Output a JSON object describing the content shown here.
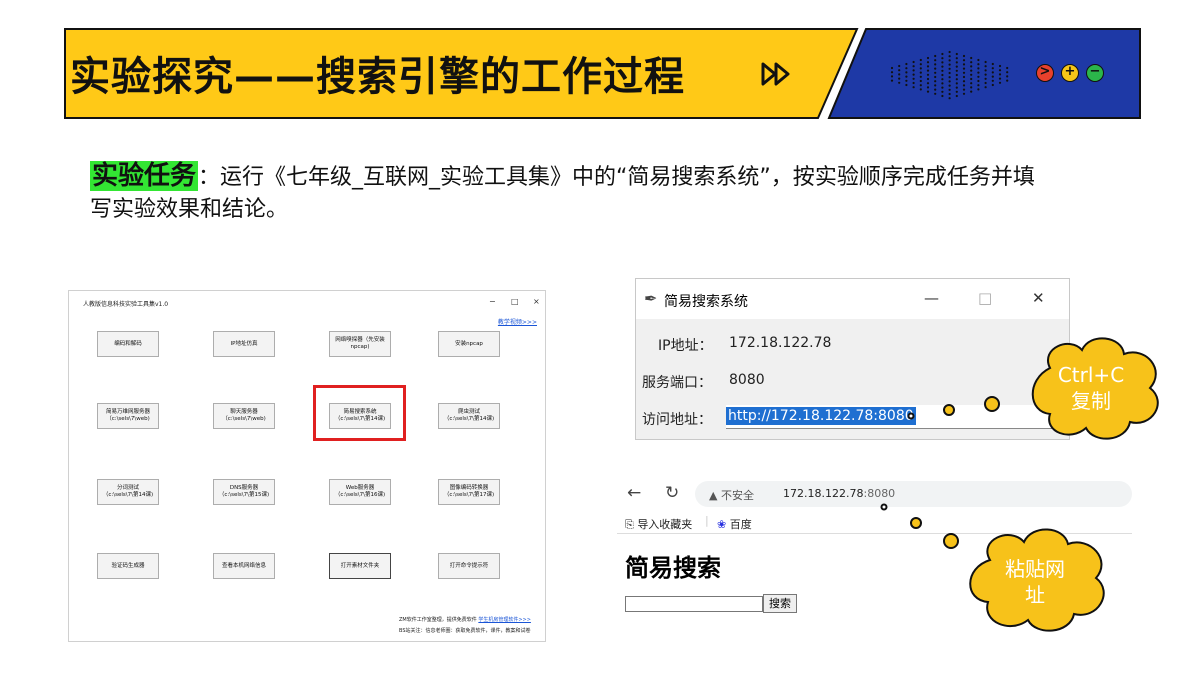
{
  "header": {
    "title": "实验探究——搜索引擎的工作过程",
    "forward_icon": "fast-forward-icon",
    "window_dots": [
      {
        "symbol": ">",
        "color": "#e8412c"
      },
      {
        "symbol": "+",
        "color": "#f5c518"
      },
      {
        "symbol": "−",
        "color": "#2bb64a"
      }
    ]
  },
  "colors": {
    "banner_yellow": "#ffc917",
    "banner_blue": "#1e39a6",
    "task_highlight": "#33e633",
    "red_box": "#e02020",
    "cloud": "#f7c21a"
  },
  "task": {
    "label": "实验任务",
    "text": "：运行《七年级_互联网_实验工具集》中的“简易搜索系统”，按实验顺序完成任务并填写实验效果和结论。"
  },
  "tool_window": {
    "title": "人教版信息科技实验工具集v1.0",
    "controls": [
      "−",
      "□",
      "×"
    ],
    "help_link": "教学视频>>>",
    "buttons": [
      "编码和解码",
      "IP地址仿真",
      "网络嗅探器（先安装npcap)",
      "安装npcap",
      "简易万维网服务器（c:\\sels\\7\\web)",
      "聊天服务器（c:\\sels\\7\\web)",
      "简易搜索系统（c:\\sels\\7\\第14课)",
      "爬虫测试（c:\\sels\\7\\第14课)",
      "分词测试（c:\\sels\\7\\第14课)",
      "DNS服务器（c:\\sels\\7\\第15课)",
      "Web服务器（c:\\sels\\7\\第16课)",
      "图像编码转换器（c:\\sels\\7\\第17课)",
      "验证码生成器",
      "查看本机网络信息",
      "打开素材文件夹",
      "打开命令提示符"
    ],
    "footer_line1": "ZM软件工作室整理，提供免费软件",
    "footer_link": "学生机房管理软件>>>",
    "footer_line2": "BS站关注：信息老师圈：获取免费软件，课件，教案和试卷"
  },
  "search_app": {
    "title": "简易搜索系统",
    "controls": [
      "—",
      "□",
      "✕"
    ],
    "ip_label": "IP地址：",
    "ip_value": "172.18.122.78",
    "port_label": "服务端口：",
    "port_value": "8080",
    "url_label": "访问地址：",
    "url_value": "http://172.18.122.78:8080"
  },
  "browser": {
    "insecure_label": "不安全",
    "host": "172.18.122.78",
    "port": ":8080",
    "bookmarks": [
      "导入收藏夹",
      "百度"
    ],
    "page_heading": "简易搜索",
    "search_button": "搜索"
  },
  "callouts": {
    "copy_line1": "Ctrl+C",
    "copy_line2": "复制",
    "paste_line1": "粘贴网",
    "paste_line2": "址"
  }
}
